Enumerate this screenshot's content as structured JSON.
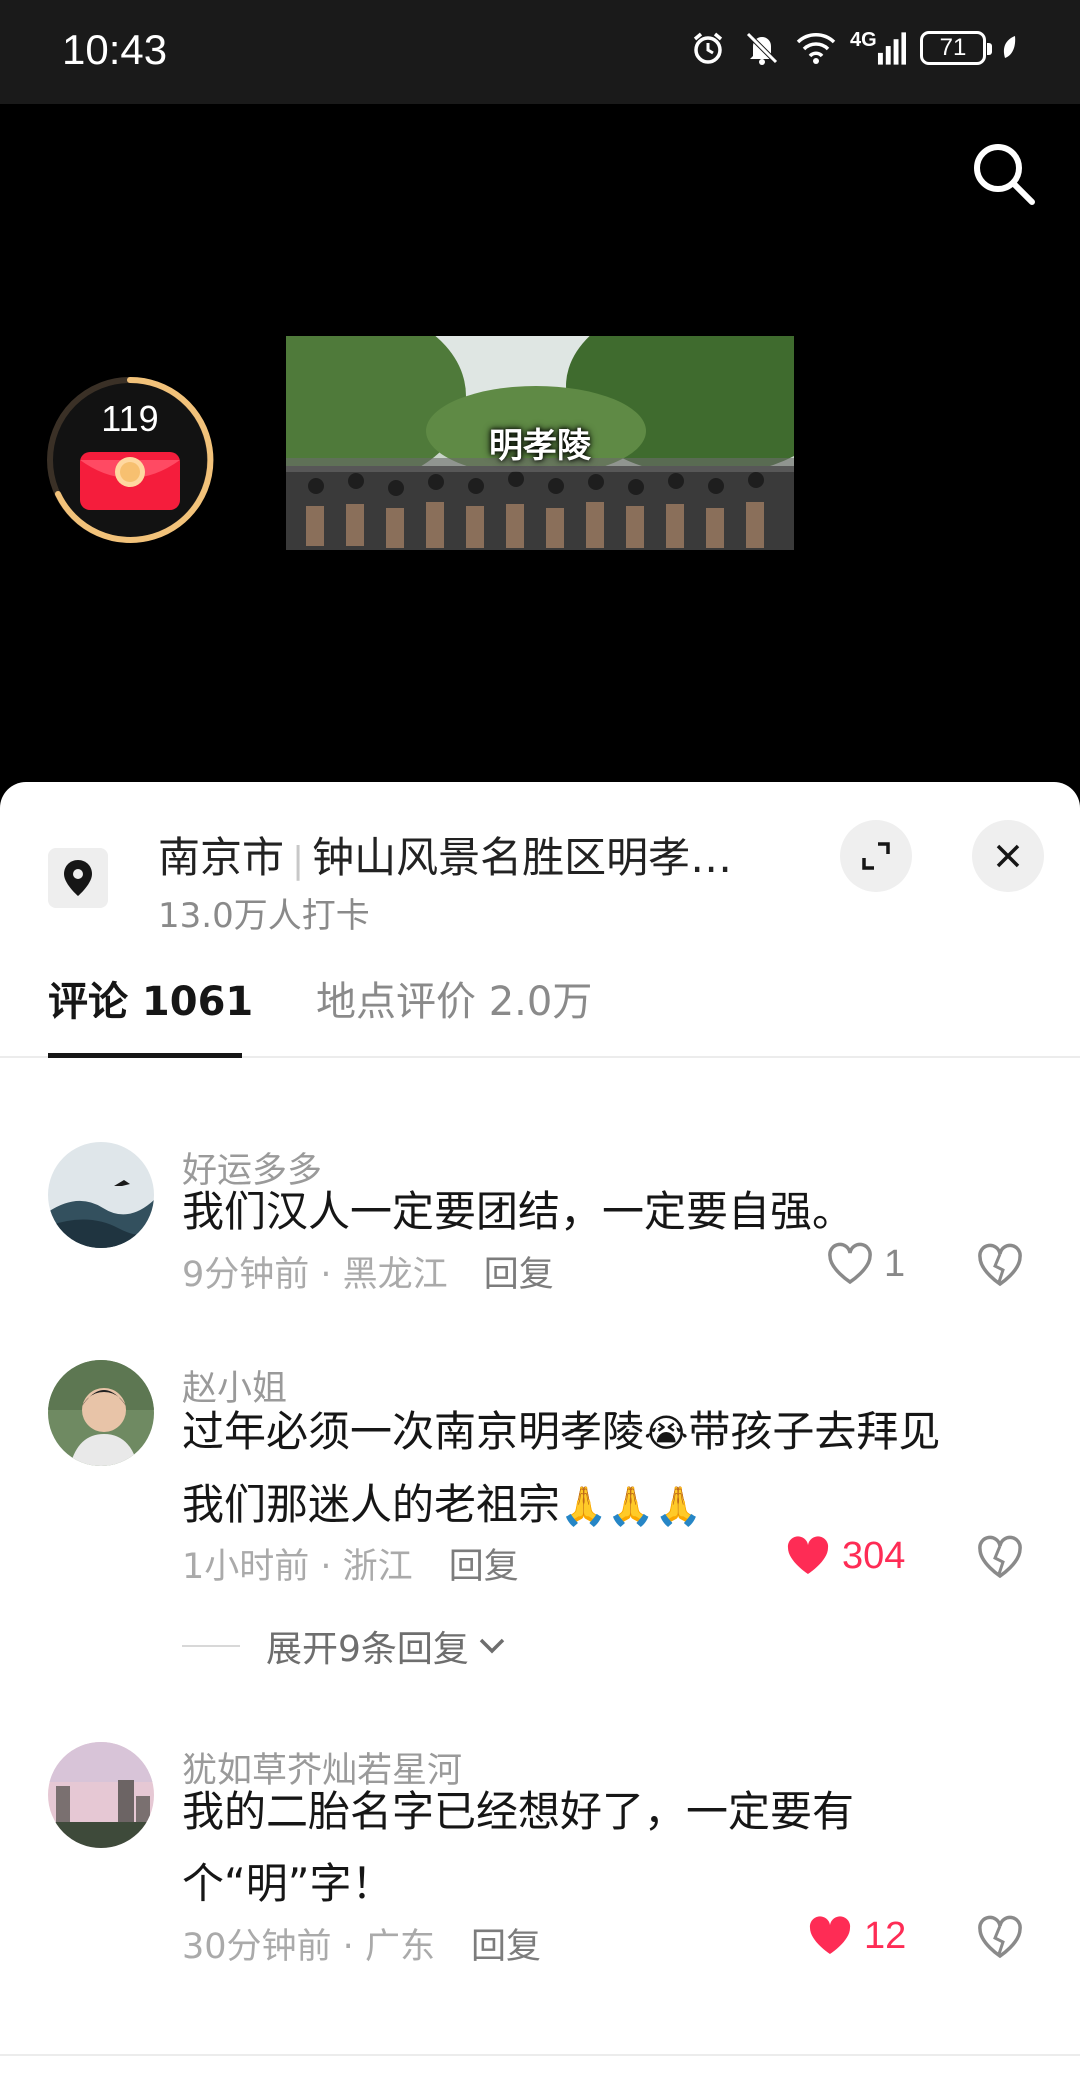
{
  "status": {
    "time": "10:43",
    "network": "4G",
    "battery": "71"
  },
  "video": {
    "red_packet_count": "119",
    "thumbnail_title": "明孝陵"
  },
  "location": {
    "city": "南京市",
    "name": "钟山风景名胜区明孝…",
    "checkins": "13.0万人打卡"
  },
  "tabs": [
    {
      "label": "评论 1061",
      "active": true
    },
    {
      "label": "地点评价 2.0万",
      "active": false
    }
  ],
  "comments": [
    {
      "user": "好运多多",
      "text": "我们汉人一定要团结，一定要自强。",
      "time": "9分钟前",
      "region": "黑龙江",
      "reply": "回复",
      "likes": "1",
      "liked": false
    },
    {
      "user": "赵小姐",
      "text_line1": "过年必须一次南京明孝陵",
      "text_emoji1": "😭",
      "text_line1b": "带孩子去拜见",
      "text_line2": "我们那迷人的老祖宗",
      "text_emoji2": "🙏🙏🙏",
      "time": "1小时前",
      "region": "浙江",
      "reply": "回复",
      "likes": "304",
      "liked": true,
      "expand_replies": "展开9条回复"
    },
    {
      "user": "犹如草芥灿若星河",
      "text_line1": "我的二胎名字已经想好了，一定要有",
      "text_line2": "个“明”字！",
      "time": "30分钟前",
      "region": "广东",
      "reply": "回复",
      "likes": "12",
      "liked": true
    }
  ],
  "meta_separator": " · ",
  "colors": {
    "like_red": "#fe2c55",
    "ring_gold": "#f2c27a",
    "sheet_bg": "#ffffff"
  },
  "icons": [
    "alarm-icon",
    "mute-icon",
    "wifi-icon",
    "signal-icon",
    "battery-icon",
    "search-icon",
    "red-packet-icon",
    "location-pin-icon",
    "expand-icon",
    "close-icon",
    "heart-icon",
    "broken-heart-icon",
    "chevron-down-icon"
  ]
}
